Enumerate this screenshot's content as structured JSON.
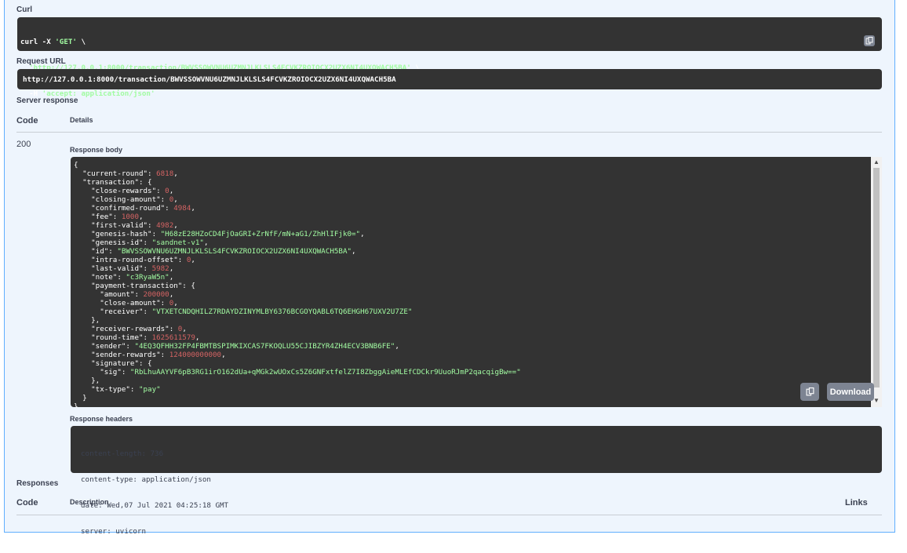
{
  "curl": {
    "label": "Curl",
    "lines": [
      {
        "a": "curl -X ",
        "b": "'GET'",
        "c": " \\"
      },
      {
        "a": "  ",
        "b": "'http://127.0.0.1:8000/transaction/BWVSSOWVNU6UZMNJLKLSLS4FCVKZROIOCX2UZX6NI4UXQWACH5BA'",
        "c": " \\"
      },
      {
        "a": "  -H ",
        "b": "'accept: application/json'",
        "c": ""
      }
    ]
  },
  "request_url": {
    "label": "Request URL",
    "value": "http://127.0.0.1:8000/transaction/BWVSSOWVNU6UZMNJLKLSLS4FCVKZROIOCX2UZX6NI4UXQWACH5BA"
  },
  "server_response": {
    "label": "Server response",
    "code_header": "Code",
    "details_header": "Details",
    "code": "200",
    "response_body_label": "Response body",
    "download_label": "Download",
    "response_headers_label": "Response headers",
    "headers": [
      "content-length: 736",
      "content-type: application/json",
      "date: Wed,07 Jul 2021 04:25:18 GMT",
      "server: uvicorn"
    ]
  },
  "body_lines": [
    [
      {
        "t": "{",
        "c": "key"
      }
    ],
    [
      {
        "t": "  \"current-round\": ",
        "c": "key"
      },
      {
        "t": "6818",
        "c": "num"
      },
      {
        "t": ",",
        "c": "key"
      }
    ],
    [
      {
        "t": "  \"transaction\": {",
        "c": "key"
      }
    ],
    [
      {
        "t": "    \"close-rewards\": ",
        "c": "key"
      },
      {
        "t": "0",
        "c": "num"
      },
      {
        "t": ",",
        "c": "key"
      }
    ],
    [
      {
        "t": "    \"closing-amount\": ",
        "c": "key"
      },
      {
        "t": "0",
        "c": "num"
      },
      {
        "t": ",",
        "c": "key"
      }
    ],
    [
      {
        "t": "    \"confirmed-round\": ",
        "c": "key"
      },
      {
        "t": "4984",
        "c": "num"
      },
      {
        "t": ",",
        "c": "key"
      }
    ],
    [
      {
        "t": "    \"fee\": ",
        "c": "key"
      },
      {
        "t": "1000",
        "c": "num"
      },
      {
        "t": ",",
        "c": "key"
      }
    ],
    [
      {
        "t": "    \"first-valid\": ",
        "c": "key"
      },
      {
        "t": "4982",
        "c": "num"
      },
      {
        "t": ",",
        "c": "key"
      }
    ],
    [
      {
        "t": "    \"genesis-hash\": ",
        "c": "key"
      },
      {
        "t": "\"H68zE28HZoCD4FjOaGRI+ZrNfF/mN+aG1/ZhHlIFjk0=\"",
        "c": "str"
      },
      {
        "t": ",",
        "c": "key"
      }
    ],
    [
      {
        "t": "    \"genesis-id\": ",
        "c": "key"
      },
      {
        "t": "\"sandnet-v1\"",
        "c": "str"
      },
      {
        "t": ",",
        "c": "key"
      }
    ],
    [
      {
        "t": "    \"id\": ",
        "c": "key"
      },
      {
        "t": "\"BWVSSOWVNU6UZMNJLKLSLS4FCVKZROIOCX2UZX6NI4UXQWACH5BA\"",
        "c": "str"
      },
      {
        "t": ",",
        "c": "key"
      }
    ],
    [
      {
        "t": "    \"intra-round-offset\": ",
        "c": "key"
      },
      {
        "t": "0",
        "c": "num"
      },
      {
        "t": ",",
        "c": "key"
      }
    ],
    [
      {
        "t": "    \"last-valid\": ",
        "c": "key"
      },
      {
        "t": "5982",
        "c": "num"
      },
      {
        "t": ",",
        "c": "key"
      }
    ],
    [
      {
        "t": "    \"note\": ",
        "c": "key"
      },
      {
        "t": "\"c3RyaW5n\"",
        "c": "str"
      },
      {
        "t": ",",
        "c": "key"
      }
    ],
    [
      {
        "t": "    \"payment-transaction\": {",
        "c": "key"
      }
    ],
    [
      {
        "t": "      \"amount\": ",
        "c": "key"
      },
      {
        "t": "200000",
        "c": "num"
      },
      {
        "t": ",",
        "c": "key"
      }
    ],
    [
      {
        "t": "      \"close-amount\": ",
        "c": "key"
      },
      {
        "t": "0",
        "c": "num"
      },
      {
        "t": ",",
        "c": "key"
      }
    ],
    [
      {
        "t": "      \"receiver\": ",
        "c": "key"
      },
      {
        "t": "\"VTXETCNDQHILZ7RDAYDZINYMLBY6376BCGOYQABL6TQ6EHGH67UXV2U7ZE\"",
        "c": "str"
      }
    ],
    [
      {
        "t": "    },",
        "c": "key"
      }
    ],
    [
      {
        "t": "    \"receiver-rewards\": ",
        "c": "key"
      },
      {
        "t": "0",
        "c": "num"
      },
      {
        "t": ",",
        "c": "key"
      }
    ],
    [
      {
        "t": "    \"round-time\": ",
        "c": "key"
      },
      {
        "t": "1625611579",
        "c": "num"
      },
      {
        "t": ",",
        "c": "key"
      }
    ],
    [
      {
        "t": "    \"sender\": ",
        "c": "key"
      },
      {
        "t": "\"4EQ3QFHH32FP4FBMTBSPIMKIXCAS7FKOQLU55CJIBZYR4ZH4ECV3BNB6FE\"",
        "c": "str"
      },
      {
        "t": ",",
        "c": "key"
      }
    ],
    [
      {
        "t": "    \"sender-rewards\": ",
        "c": "key"
      },
      {
        "t": "124000000000",
        "c": "num"
      },
      {
        "t": ",",
        "c": "key"
      }
    ],
    [
      {
        "t": "    \"signature\": {",
        "c": "key"
      }
    ],
    [
      {
        "t": "      \"sig\": ",
        "c": "key"
      },
      {
        "t": "\"RbLhuAAYVF6pB3RG1irO162dUa+qMGk2wUOxCs5Z6GNFxtfelZ7I8ZbggAieMLEfCDCkr9UuoRJmP2qacqigBw==\"",
        "c": "str"
      }
    ],
    [
      {
        "t": "    },",
        "c": "key"
      }
    ],
    [
      {
        "t": "    \"tx-type\": ",
        "c": "key"
      },
      {
        "t": "\"pay\"",
        "c": "str"
      }
    ],
    [
      {
        "t": "  }",
        "c": "key"
      }
    ],
    [
      {
        "t": "}",
        "c": "key"
      }
    ]
  ],
  "responses": {
    "label": "Responses",
    "code_header": "Code",
    "description_header": "Description",
    "links_header": "Links"
  },
  "icons": {
    "copy": "copy-icon",
    "scroll_up": "arrow-up-icon",
    "scroll_down": "arrow-down-icon"
  }
}
